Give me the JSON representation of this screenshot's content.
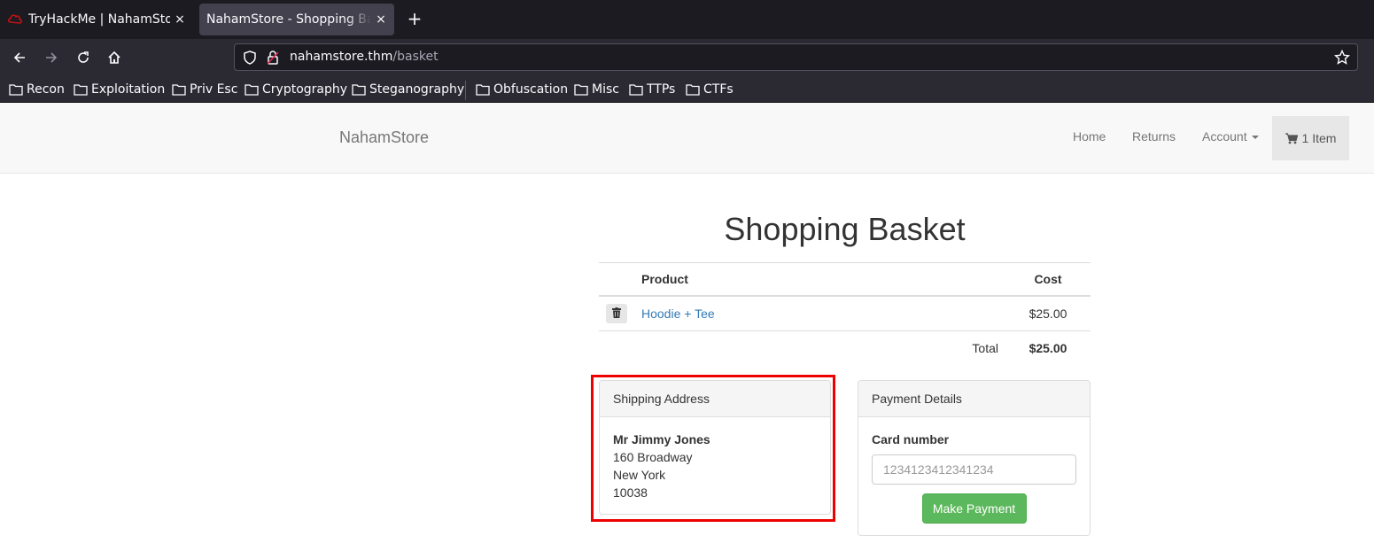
{
  "browser": {
    "tabs": [
      {
        "title": "TryHackMe | NahamStore",
        "active": false
      },
      {
        "title": "NahamStore - Shopping Basket",
        "active": true
      }
    ],
    "new_tab_label": "+",
    "close_label": "×",
    "url": {
      "host": "nahamstore.thm",
      "path": "/basket"
    },
    "bookmarks": [
      "Recon",
      "Exploitation",
      "Priv Esc",
      "Cryptography",
      "Steganography",
      "Obfuscation",
      "Misc",
      "TTPs",
      "CTFs"
    ],
    "colors": {
      "tab_bar": "#1c1b22",
      "toolbar": "#2b2a33",
      "active_tab": "#42414d"
    }
  },
  "site": {
    "brand": "NahamStore",
    "nav": {
      "home": "Home",
      "returns": "Returns",
      "account": "Account",
      "cart": "1 Item"
    }
  },
  "basket": {
    "title": "Shopping Basket",
    "columns": {
      "product": "Product",
      "cost": "Cost"
    },
    "items": [
      {
        "product": "Hoodie + Tee",
        "cost": "$25.00"
      }
    ],
    "total_label": "Total",
    "total_value": "$25.00"
  },
  "shipping": {
    "heading": "Shipping Address",
    "name": "Mr Jimmy Jones",
    "line1": "160 Broadway",
    "city": "New York",
    "zip": "10038"
  },
  "payment": {
    "heading": "Payment Details",
    "card_label": "Card number",
    "card_placeholder": "1234123412341234",
    "button": "Make Payment",
    "button_color": "#5cb85c"
  },
  "highlight_color": "#ee0000"
}
